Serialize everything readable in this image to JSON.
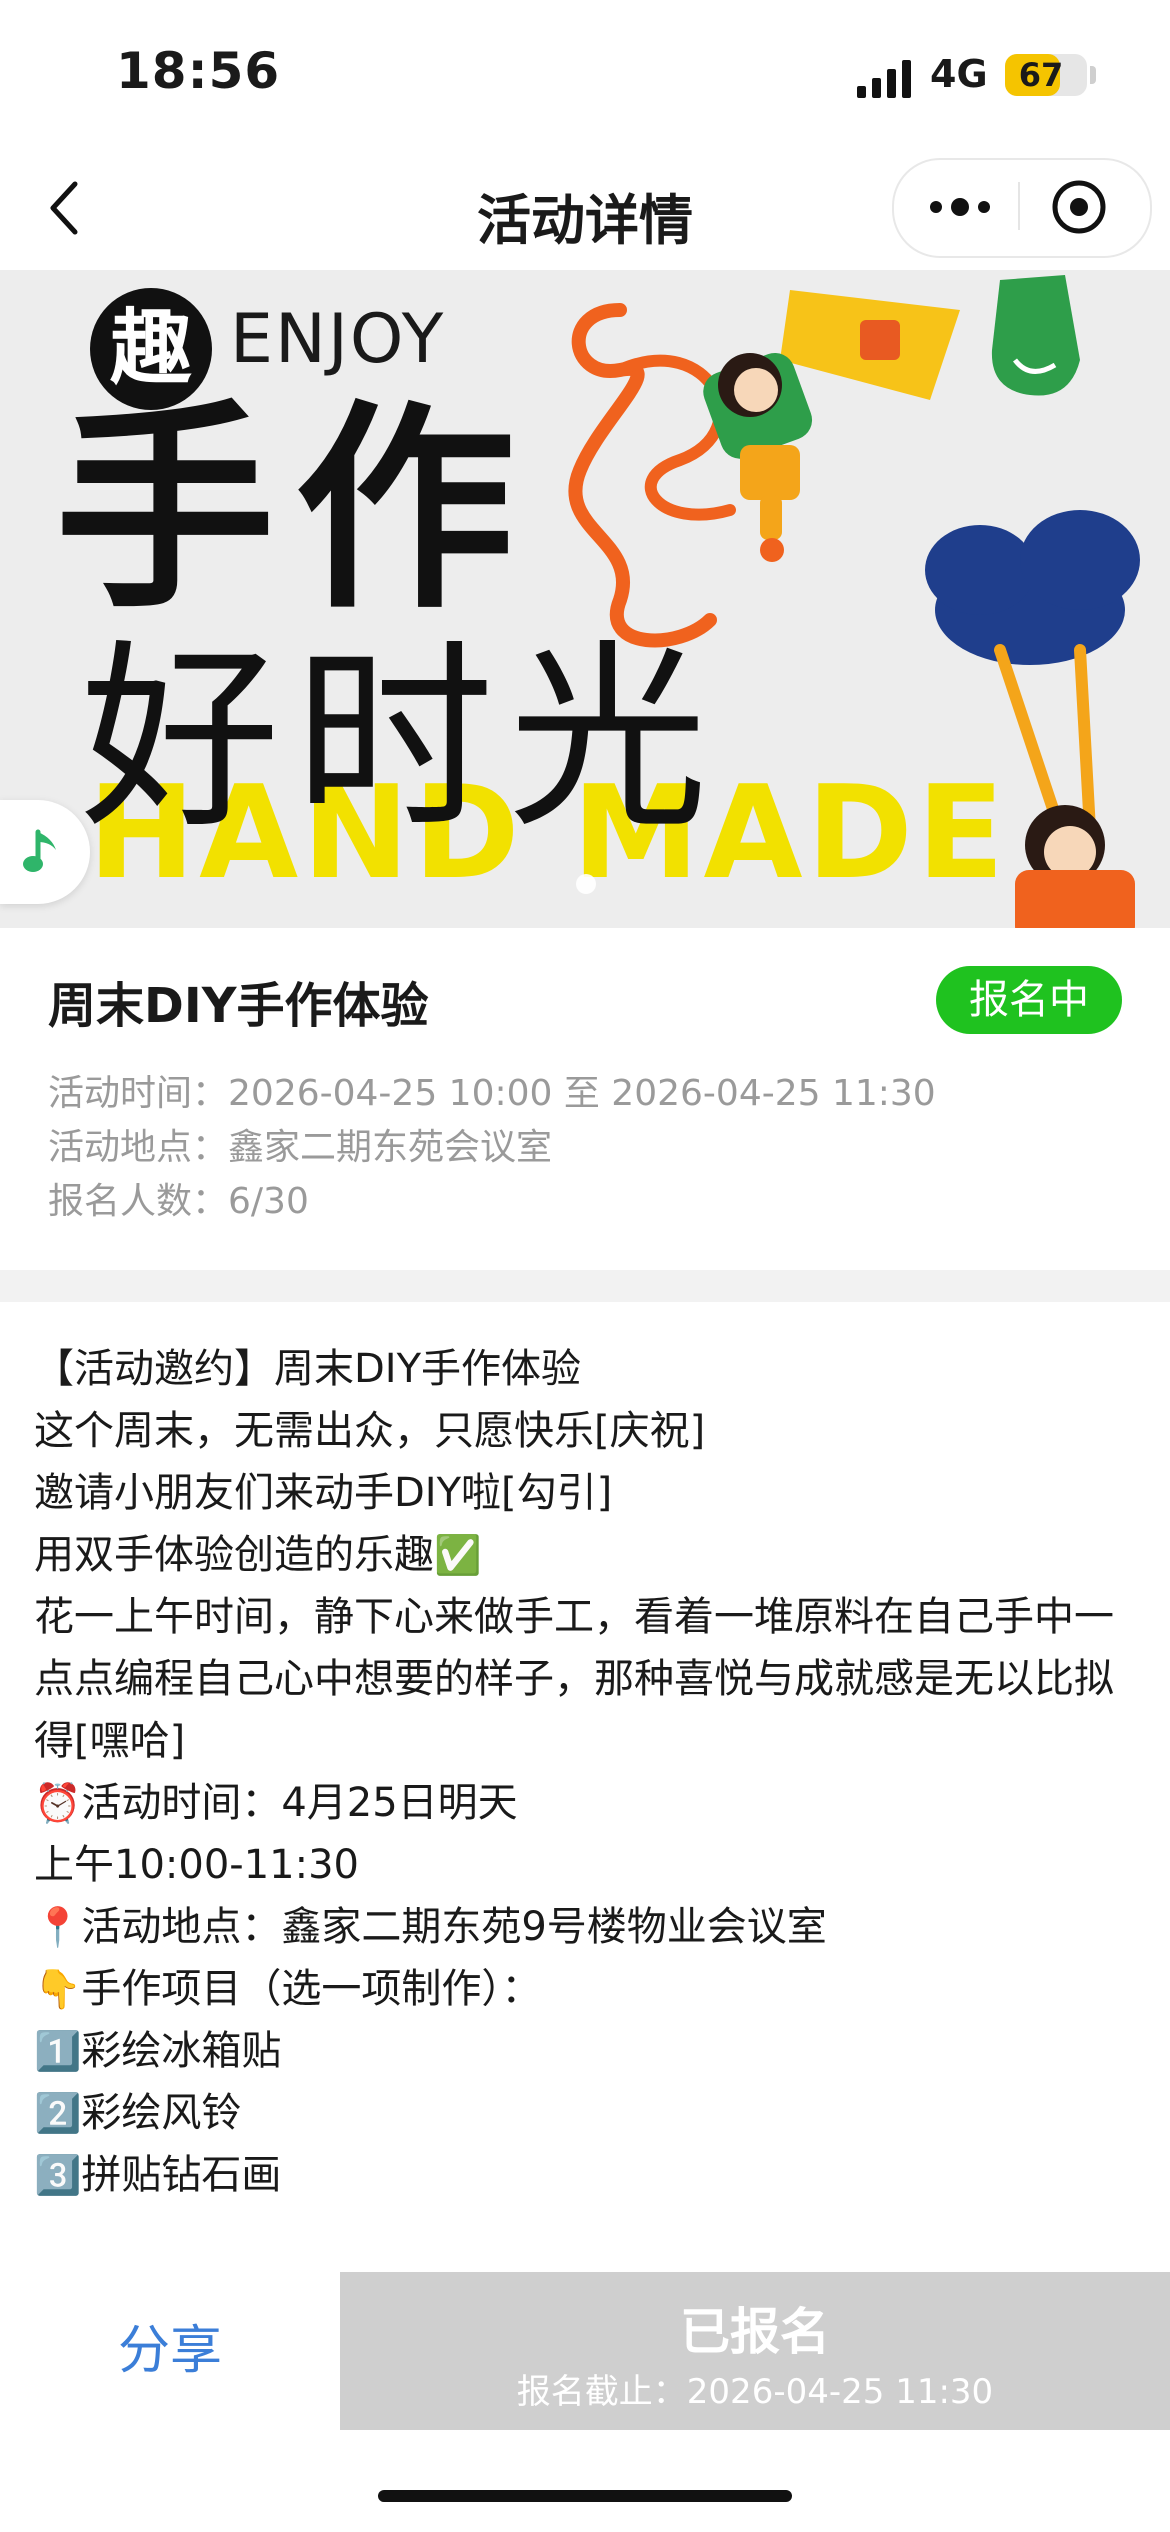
{
  "status_bar": {
    "time": "18:56",
    "network": "4G",
    "battery": "67",
    "battery_level": 0.67
  },
  "nav": {
    "title": "活动详情"
  },
  "banner": {
    "qu": "趣",
    "enjoy": "ENJOY",
    "line1": "手作",
    "line2": "好时光",
    "line3": "HAND MADE"
  },
  "event": {
    "title": "周末DIY手作体验",
    "status": "报名中",
    "time_label": "活动时间：",
    "time_value": "2026-04-25 10:00 至 2026-04-25 11:30",
    "place_label": "活动地点：",
    "place_value": "鑫家二期东苑会议室",
    "count_label": "报名人数：",
    "count_value": "6/30"
  },
  "description": {
    "l1": "【活动邀约】周末DIY手作体验",
    "l2": " 这个周末，无需出众，只愿快乐[庆祝]",
    "l3": "邀请小朋友们来动手DIY啦[勾引]",
    "l4": "用双手体验创造的乐趣",
    "l5": "花一上午时间，静下心来做手工，看着一堆原料在自己手中一点点编程自己心中想要的样子，那种喜悦与成就感是无以比拟得[嘿哈]",
    "l6": "活动时间：4月25日明天",
    "l7": "上午10:00-11:30",
    "l8": "活动地点：鑫家二期东苑9号楼物业会议室",
    "l9": "手作项目（选一项制作）：",
    "l10": "彩绘冰箱贴",
    "l11": "彩绘风铃",
    "l12": "拼贴钻石画"
  },
  "bottom": {
    "share": "分享",
    "signed": "已报名",
    "deadline": "报名截止：2026-04-25 11:30"
  },
  "colors": {
    "green": "#1fc21f",
    "blue": "#3b7ed8",
    "disabled": "#cfcfcf"
  }
}
